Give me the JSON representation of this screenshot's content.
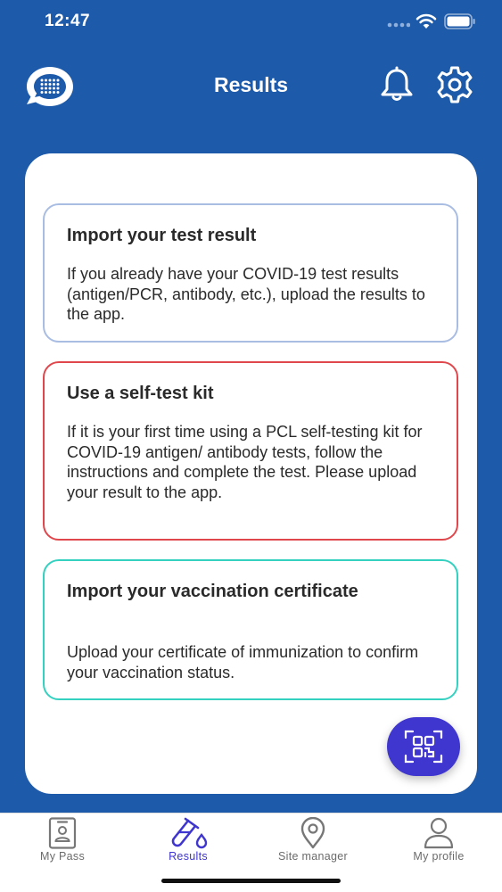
{
  "status_bar": {
    "time": "12:47"
  },
  "header": {
    "title": "Results"
  },
  "options": [
    {
      "title": "Import your test result",
      "description": "If you already have your COVID-19 test results (antigen/PCR, antibody, etc.), upload the results to the app."
    },
    {
      "title": "Use a self-test kit",
      "description": "If it is your first time using a PCL self-testing kit for COVID-19 antigen/ antibody tests, follow the instructions and complete the test. Please upload your result to the app."
    },
    {
      "title": "Import your vaccination certificate",
      "description": "Upload your certificate of immunization to confirm your vaccination status."
    }
  ],
  "tabs": [
    {
      "label": "My Pass",
      "icon": "id-badge-icon"
    },
    {
      "label": "Results",
      "icon": "test-tube-icon",
      "active": true
    },
    {
      "label": "Site manager",
      "icon": "map-pin-icon"
    },
    {
      "label": "My profile",
      "icon": "person-icon"
    }
  ],
  "colors": {
    "brand_blue": "#1d5aa9",
    "accent_purple": "#3f35cf",
    "card_import_border": "#a9bde3",
    "card_selftest_border": "#e0474c",
    "card_vaccine_border": "#35d1c0"
  }
}
